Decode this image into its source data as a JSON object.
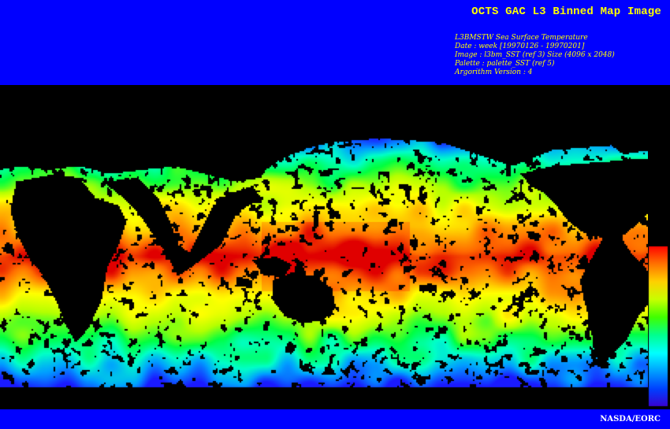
{
  "header": {
    "title": "OCTS GAC L3 Binned Map Image",
    "meta_lines": [
      "L3BMSTW Sea Surface Temperature",
      "Date : week [19970126 - 19970201]",
      "Image : l3bm_SST (ref 3) Size (4096 x 2048)",
      "Palette : palette_SST (ref 5)",
      "Argorithm Version : 4"
    ]
  },
  "map": {
    "land_color": "#000000",
    "palette": [
      "#1a1aff",
      "#00a0ff",
      "#00ffc8",
      "#00ff40",
      "#b4ff00",
      "#ffff00",
      "#ffb400",
      "#ff6a00",
      "#e00000"
    ]
  },
  "colorbar": {
    "colors_top_to_bottom": [
      "#ff0000",
      "#ff7000",
      "#ffd000",
      "#c8ff00",
      "#40ff00",
      "#00ff90",
      "#00ffff",
      "#00a0ff",
      "#0040ff",
      "#3a00d0"
    ]
  },
  "footer": {
    "credit": "NASDA/EORC"
  }
}
